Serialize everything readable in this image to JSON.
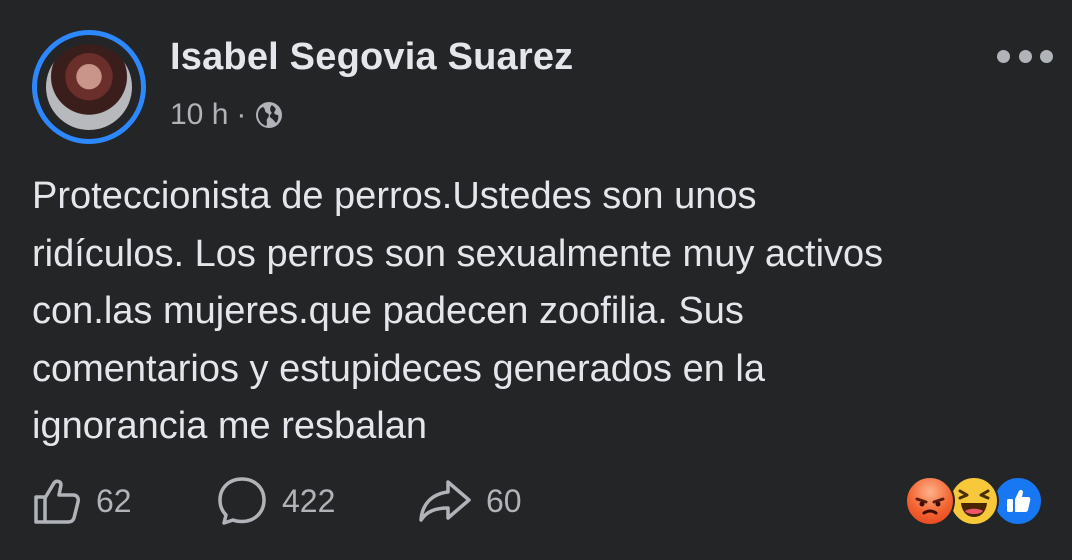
{
  "post": {
    "author": "Isabel Segovia Suarez",
    "time": "10 h",
    "separator": "·",
    "privacy_icon": "globe-icon",
    "menu_icon": "more-options-icon",
    "text_lines": [
      "Proteccionista de perros.Ustedes son unos",
      "ridículos. Los perros son sexualmente muy activos",
      "con.las mujeres.que padecen zoofilia. Sus",
      "comentarios y estupideces generados en la",
      "ignorancia me resbalan"
    ]
  },
  "actions": {
    "like_count": "62",
    "comment_count": "422",
    "share_count": "60"
  },
  "reactions": [
    "angry",
    "haha",
    "like"
  ],
  "colors": {
    "background": "#242526",
    "text": "#e4e6eb",
    "secondary_text": "#b0b3b8",
    "avatar_ring": "#2d88ff",
    "like_reaction": "#1877f2"
  }
}
